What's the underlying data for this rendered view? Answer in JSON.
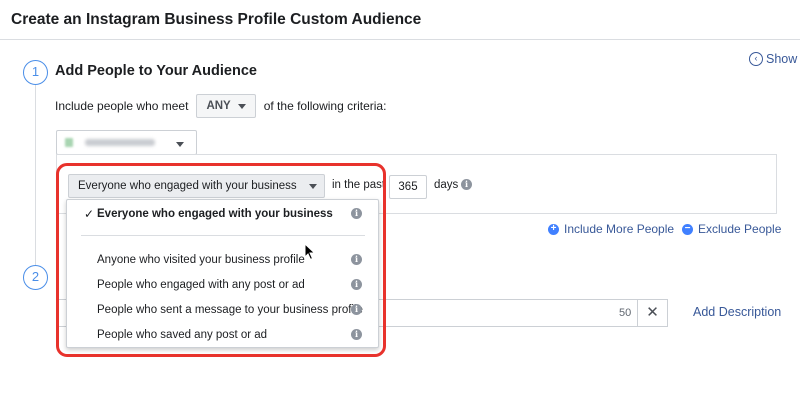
{
  "header": {
    "title": "Create an Instagram Business Profile Custom Audience"
  },
  "step1": {
    "number": "1",
    "title": "Add People to Your Audience",
    "show_label": "Show",
    "criteria_prefix": "Include people who meet",
    "match_value": "ANY",
    "criteria_suffix": "of the following criteria:"
  },
  "rule": {
    "engagement_selected": "Everyone who engaged with your business",
    "in_the_past": "in the past",
    "days_value": "365",
    "days_label": "days"
  },
  "dropdown": {
    "selected_label": "Everyone who engaged with your business",
    "options": [
      "Anyone who visited your business profile",
      "People who engaged with any post or ad",
      "People who sent a message to your business profile",
      "People who saved any post or ad"
    ]
  },
  "actions": {
    "include_more": "Include More People",
    "exclude": "Exclude People"
  },
  "step2": {
    "number": "2",
    "char_count": "50",
    "clear_label": "✕",
    "add_description": "Add Description"
  },
  "colors": {
    "accent": "#4080ff",
    "link": "#385898",
    "highlight": "#e8322c"
  }
}
